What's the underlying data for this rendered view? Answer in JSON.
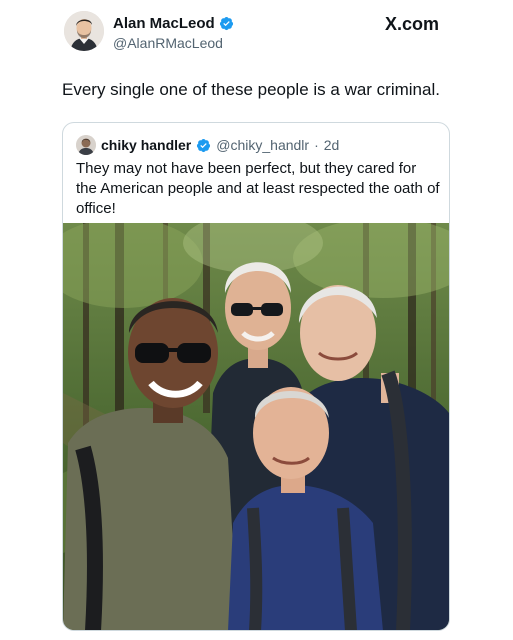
{
  "post": {
    "author_name": "Alan MacLeod",
    "author_handle": "@AlanRMacLeod",
    "verified_icon": "verified-badge-icon",
    "site_label": "X.com",
    "text": "Every single one of these people is a war criminal."
  },
  "quoted_post": {
    "author_name": "chiky handler",
    "author_handle": "@chiky_handlr",
    "separator": "·",
    "time": "2d",
    "verified_icon": "verified-badge-icon",
    "text": "They may not have been perfect, but they cared for the American people and at least respected the oath of office!",
    "image_icon": "group-selfie-photo"
  },
  "colors": {
    "verified": "#1d9bf0",
    "secondary_text": "#536471",
    "primary_text": "#0f1419",
    "border": "#cfd9de"
  }
}
